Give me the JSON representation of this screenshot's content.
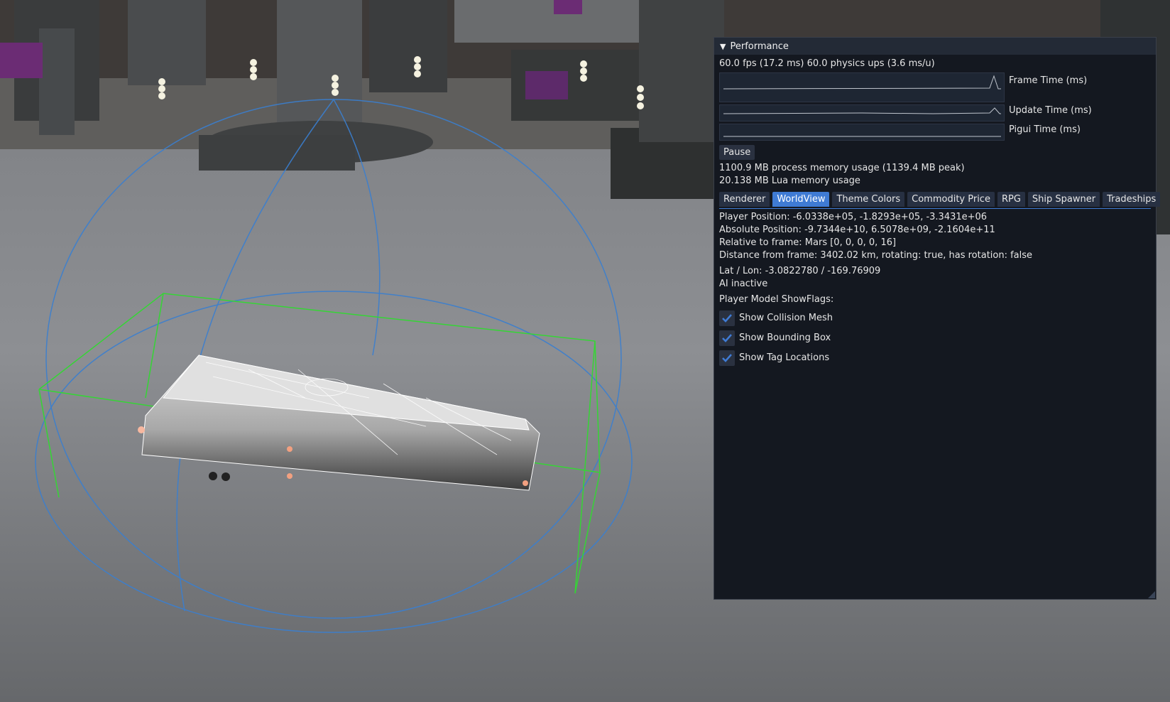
{
  "panel": {
    "title": "Performance",
    "fps_line": "60.0 fps (17.2 ms) 60.0 physics ups (3.6 ms/u)",
    "plots": [
      {
        "label": "Frame Time (ms)"
      },
      {
        "label": "Update Time (ms)"
      },
      {
        "label": "Pigui Time (ms)"
      }
    ],
    "pause_label": "Pause",
    "memory_line": "1100.9 MB process memory usage (1139.4 MB peak)",
    "lua_line": "20.138 MB Lua memory usage",
    "tabs": [
      {
        "label": "Renderer"
      },
      {
        "label": "WorldView"
      },
      {
        "label": "Theme Colors"
      },
      {
        "label": "Commodity Price"
      },
      {
        "label": "RPG"
      },
      {
        "label": "Ship Spawner"
      },
      {
        "label": "Tradeships"
      }
    ],
    "active_tab": "WorldView",
    "worldview": {
      "player_position": "Player Position: -6.0338e+05, -1.8293e+05, -3.3431e+06",
      "absolute_position": "Absolute Position: -9.7344e+10, 6.5078e+09, -2.1604e+11",
      "relative_frame": "Relative to frame: Mars [0, 0, 0, 0, 16]",
      "distance": "Distance from frame: 3402.02 km, rotating: true, has rotation: false",
      "latlon": "Lat / Lon: -3.0822780 / -169.76909",
      "ai_status": "AI inactive",
      "showflags_label": "Player Model ShowFlags:",
      "checkboxes": [
        {
          "label": "Show Collision Mesh",
          "checked": true
        },
        {
          "label": "Show Bounding Box",
          "checked": true
        },
        {
          "label": "Show Tag Locations",
          "checked": true
        }
      ]
    }
  },
  "colors": {
    "accent": "#3f7bd4",
    "panel_bg": "#141820",
    "bounding_box": "#35d535",
    "collision_sphere": "#3a7fd0"
  }
}
